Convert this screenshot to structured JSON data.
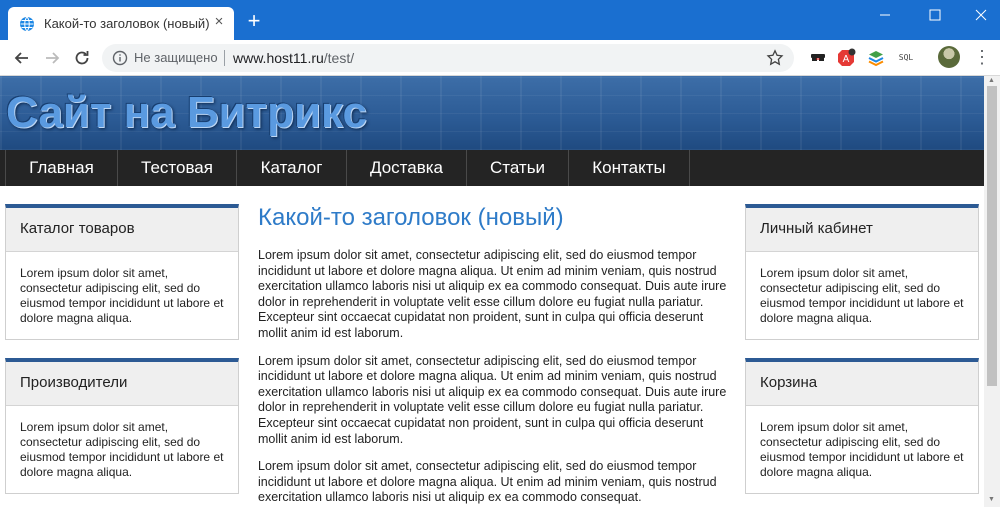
{
  "browser": {
    "tab_title": "Какой-то заголовок (новый)",
    "tab_close": "×",
    "new_tab": "+",
    "insecure_label": "Не защищено",
    "url_host": "www.host11.ru",
    "url_path": "/test/",
    "ext_sql_label": "SQL",
    "colors": {
      "titlebar": "#1a6fd0",
      "toolbar": "#ffffff",
      "omnibox": "#f1f3f4"
    }
  },
  "site": {
    "title": "Сайт на Битрикс",
    "menu": [
      "Главная",
      "Тестовая",
      "Каталог",
      "Доставка",
      "Статьи",
      "Контакты"
    ],
    "colors": {
      "menu_bg": "#242424",
      "accent": "#2c5a94",
      "heading": "#2e7bc8"
    }
  },
  "left_blocks": [
    {
      "title": "Каталог товаров",
      "text": "Lorem ipsum dolor sit amet, consectetur adipiscing elit, sed do eiusmod tempor incididunt ut labore et dolore magna aliqua."
    },
    {
      "title": "Производители",
      "text": "Lorem ipsum dolor sit amet, consectetur adipiscing elit, sed do eiusmod tempor incididunt ut labore et dolore magna aliqua."
    }
  ],
  "right_blocks": [
    {
      "title": "Личный кабинет",
      "text": "Lorem ipsum dolor sit amet, consectetur adipiscing elit, sed do eiusmod tempor incididunt ut labore et dolore magna aliqua."
    },
    {
      "title": "Корзина",
      "text": "Lorem ipsum dolor sit amet, consectetur adipiscing elit, sed do eiusmod tempor incididunt ut labore et dolore magna aliqua."
    }
  ],
  "main": {
    "heading": "Какой-то заголовок (новый)",
    "paragraphs": [
      "Lorem ipsum dolor sit amet, consectetur adipiscing elit, sed do eiusmod tempor incididunt ut labore et dolore magna aliqua. Ut enim ad minim veniam, quis nostrud exercitation ullamco laboris nisi ut aliquip ex ea commodo consequat. Duis aute irure dolor in reprehenderit in voluptate velit esse cillum dolore eu fugiat nulla pariatur. Excepteur sint occaecat cupidatat non proident, sunt in culpa qui officia deserunt mollit anim id est laborum.",
      "Lorem ipsum dolor sit amet, consectetur adipiscing elit, sed do eiusmod tempor incididunt ut labore et dolore magna aliqua. Ut enim ad minim veniam, quis nostrud exercitation ullamco laboris nisi ut aliquip ex ea commodo consequat. Duis aute irure dolor in reprehenderit in voluptate velit esse cillum dolore eu fugiat nulla pariatur. Excepteur sint occaecat cupidatat non proident, sunt in culpa qui officia deserunt mollit anim id est laborum.",
      "Lorem ipsum dolor sit amet, consectetur adipiscing elit, sed do eiusmod tempor incididunt ut labore et dolore magna aliqua. Ut enim ad minim veniam, quis nostrud exercitation ullamco laboris nisi ut aliquip ex ea commodo consequat."
    ]
  }
}
